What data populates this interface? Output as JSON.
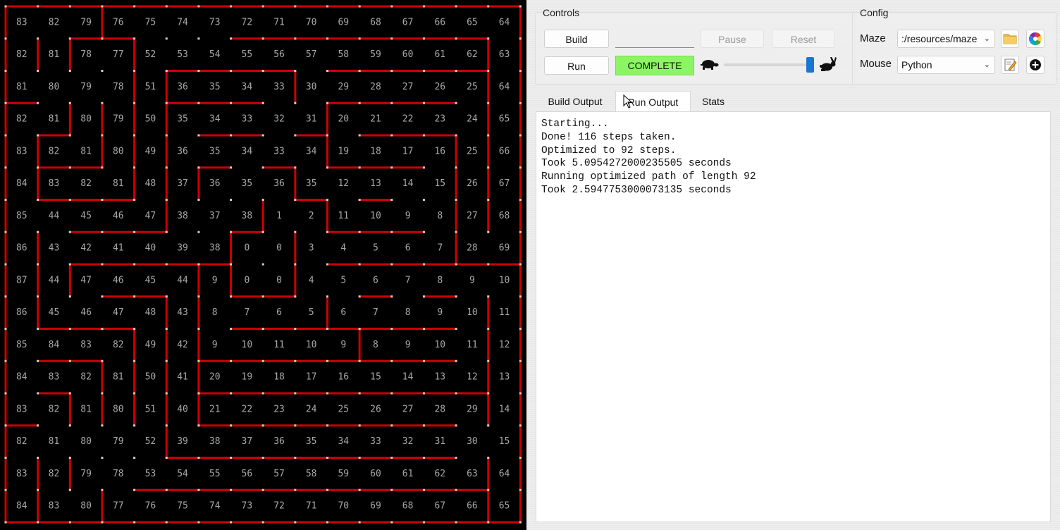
{
  "maze": {
    "numbers": [
      [
        83,
        82,
        79,
        76,
        75,
        74,
        73,
        72,
        71,
        70,
        69,
        68,
        67,
        66,
        65,
        64
      ],
      [
        82,
        81,
        78,
        77,
        52,
        53,
        54,
        55,
        56,
        57,
        58,
        59,
        60,
        61,
        62,
        63
      ],
      [
        81,
        80,
        79,
        78,
        51,
        36,
        35,
        34,
        33,
        30,
        29,
        28,
        27,
        26,
        25,
        64
      ],
      [
        82,
        81,
        80,
        79,
        50,
        35,
        34,
        33,
        32,
        31,
        20,
        21,
        22,
        23,
        24,
        65
      ],
      [
        83,
        82,
        81,
        80,
        49,
        36,
        35,
        34,
        33,
        34,
        19,
        18,
        17,
        16,
        25,
        66
      ],
      [
        84,
        83,
        82,
        81,
        48,
        37,
        36,
        35,
        36,
        35,
        12,
        13,
        14,
        15,
        26,
        67
      ],
      [
        85,
        44,
        45,
        46,
        47,
        38,
        37,
        38,
        1,
        2,
        11,
        10,
        9,
        8,
        27,
        68
      ],
      [
        86,
        43,
        42,
        41,
        40,
        39,
        38,
        0,
        0,
        3,
        4,
        5,
        6,
        7,
        28,
        69
      ],
      [
        87,
        44,
        47,
        46,
        45,
        44,
        9,
        0,
        0,
        4,
        5,
        6,
        7,
        8,
        9,
        10
      ],
      [
        86,
        45,
        46,
        47,
        48,
        43,
        8,
        7,
        6,
        5,
        6,
        7,
        8,
        9,
        10,
        11
      ],
      [
        85,
        84,
        83,
        82,
        49,
        42,
        9,
        10,
        11,
        10,
        9,
        8,
        9,
        10,
        11,
        12
      ],
      [
        84,
        83,
        82,
        81,
        50,
        41,
        20,
        19,
        18,
        17,
        16,
        15,
        14,
        13,
        12,
        13
      ],
      [
        83,
        82,
        81,
        80,
        51,
        40,
        21,
        22,
        23,
        24,
        25,
        26,
        27,
        28,
        29,
        14
      ],
      [
        82,
        81,
        80,
        79,
        52,
        39,
        38,
        37,
        36,
        35,
        34,
        33,
        32,
        31,
        30,
        15
      ],
      [
        83,
        82,
        79,
        78,
        53,
        54,
        55,
        56,
        57,
        58,
        59,
        60,
        61,
        62,
        63,
        64
      ],
      [
        84,
        83,
        80,
        77,
        76,
        75,
        74,
        73,
        72,
        71,
        70,
        69,
        68,
        67,
        66,
        65
      ]
    ],
    "colors": {
      "background": "#000000",
      "wall": "#cc0000",
      "post": "#cfcfcf",
      "text": "#a8a8a8"
    }
  },
  "controls": {
    "title": "Controls",
    "build_label": "Build",
    "run_label": "Run",
    "pause_label": "Pause",
    "reset_label": "Reset",
    "status_text": "COMPLETE",
    "status_color": "#8cf564",
    "speed_fraction": 1.0,
    "slow_icon": "turtle-icon",
    "fast_icon": "rabbit-icon"
  },
  "config": {
    "title": "Config",
    "maze_label": "Maze",
    "maze_value": ":/resources/maze",
    "mouse_label": "Mouse",
    "mouse_value": "Python",
    "maze_browse_icon": "folder-icon",
    "maze_color_icon": "color-wheel-icon",
    "mouse_edit_icon": "edit-icon",
    "mouse_add_icon": "add-icon"
  },
  "tabs": {
    "build_output": "Build Output",
    "run_output": "Run Output",
    "stats": "Stats"
  },
  "output_lines": [
    "Starting...",
    "Done! 116 steps taken.",
    "Optimized to 92 steps.",
    "Took 5.0954272000235505 seconds",
    "Running optimized path of length 92",
    "Took 2.5947753000073135 seconds"
  ]
}
